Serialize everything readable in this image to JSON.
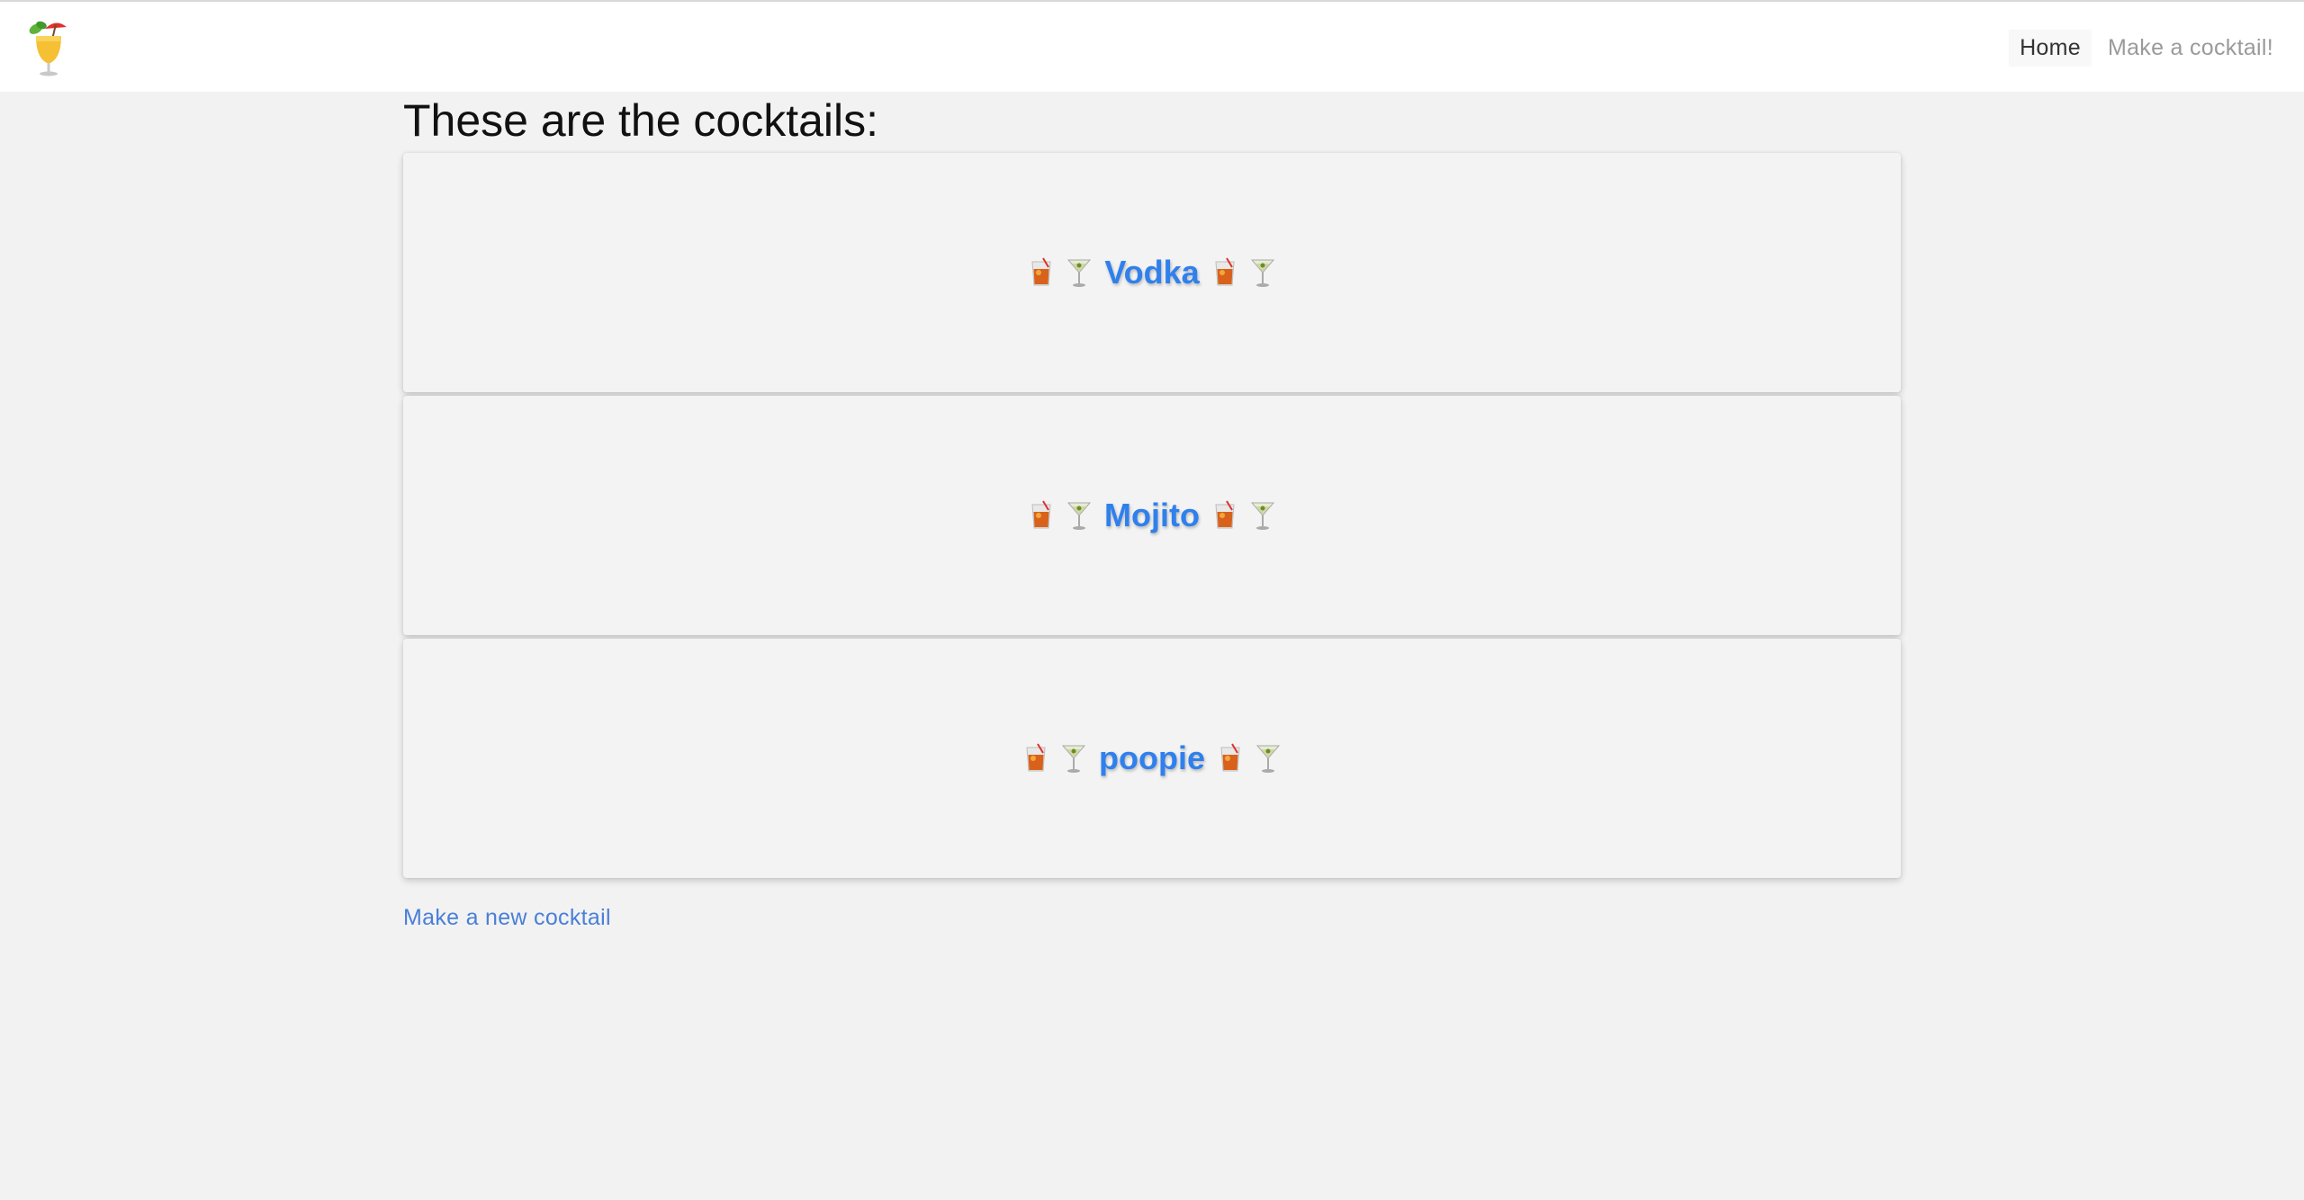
{
  "navbar": {
    "logo_icon": "tropical-drink-icon",
    "links": [
      {
        "label": "Home",
        "active": true
      },
      {
        "label": "Make a cocktail!",
        "active": false
      }
    ]
  },
  "main": {
    "title": "These are the cocktails:",
    "cocktails": [
      {
        "name": "Vodka"
      },
      {
        "name": "Mojito"
      },
      {
        "name": "poopie"
      }
    ],
    "new_cocktail_link": "Make a new cocktail"
  },
  "colors": {
    "background": "#f2f2f2",
    "card": "#f3f3f3",
    "link": "#2f80ed",
    "nav_active": "#333333",
    "nav_inactive": "#9a9a9a"
  }
}
